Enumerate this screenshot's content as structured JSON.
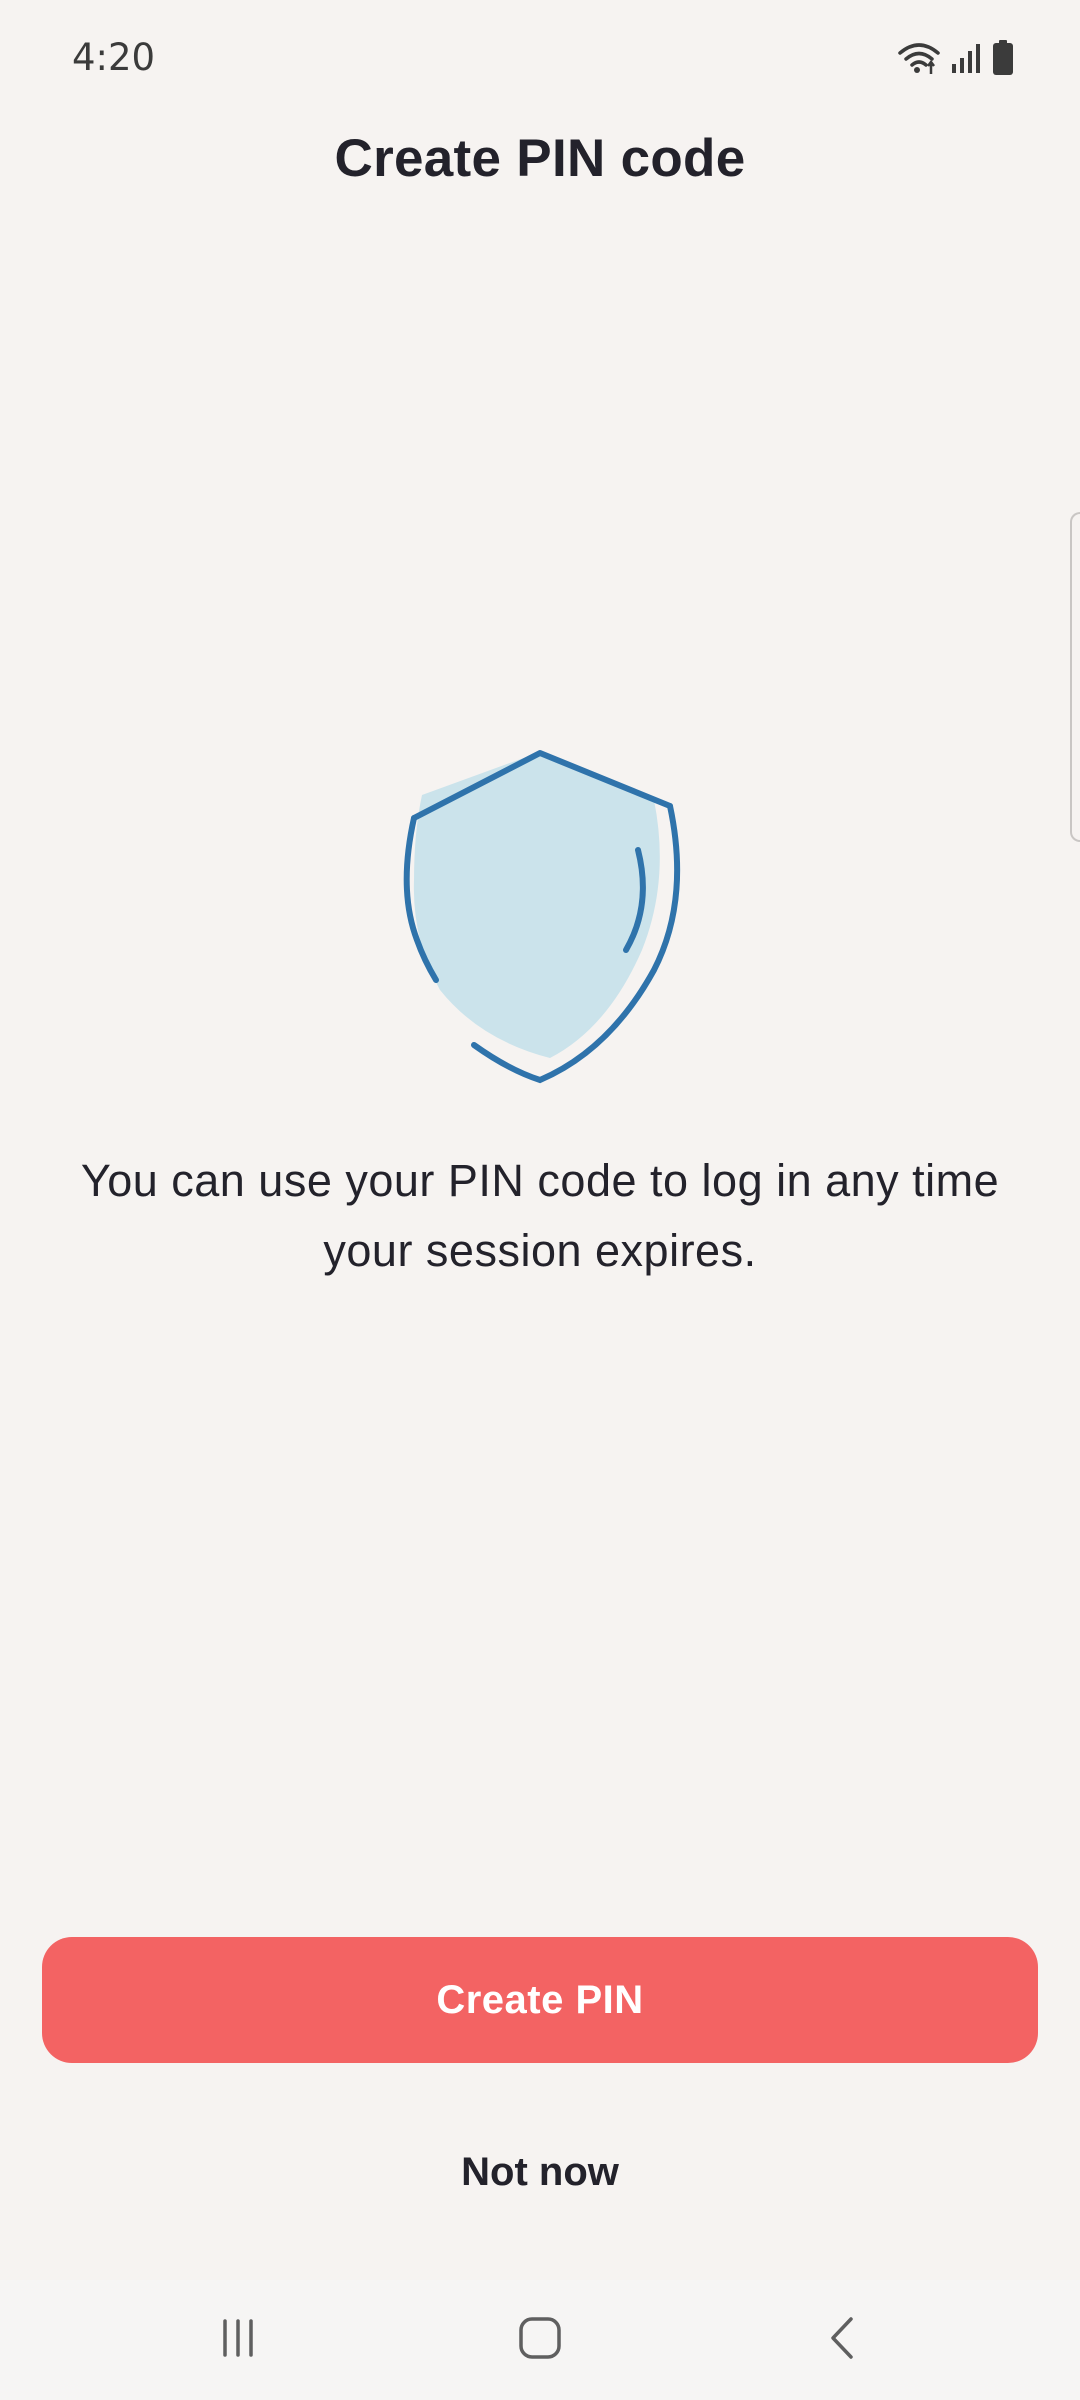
{
  "status_bar": {
    "time": "4:20",
    "icons": [
      "wifi-icon",
      "cellular-signal-icon",
      "battery-icon"
    ]
  },
  "header": {
    "title": "Create PIN code"
  },
  "illustration": {
    "icon": "shield-icon"
  },
  "main": {
    "description": "You can use your PIN code to log in any time your session expires."
  },
  "actions": {
    "primary_label": "Create PIN",
    "secondary_label": "Not now"
  },
  "nav_bar": {
    "buttons": [
      "recent-apps-icon",
      "home-icon",
      "back-icon"
    ]
  },
  "colors": {
    "background": "#f6f3f1",
    "accent": "#f36363",
    "shield_stroke": "#2f73ab",
    "shield_fill": "#cbe3eb",
    "text": "#23222b"
  }
}
